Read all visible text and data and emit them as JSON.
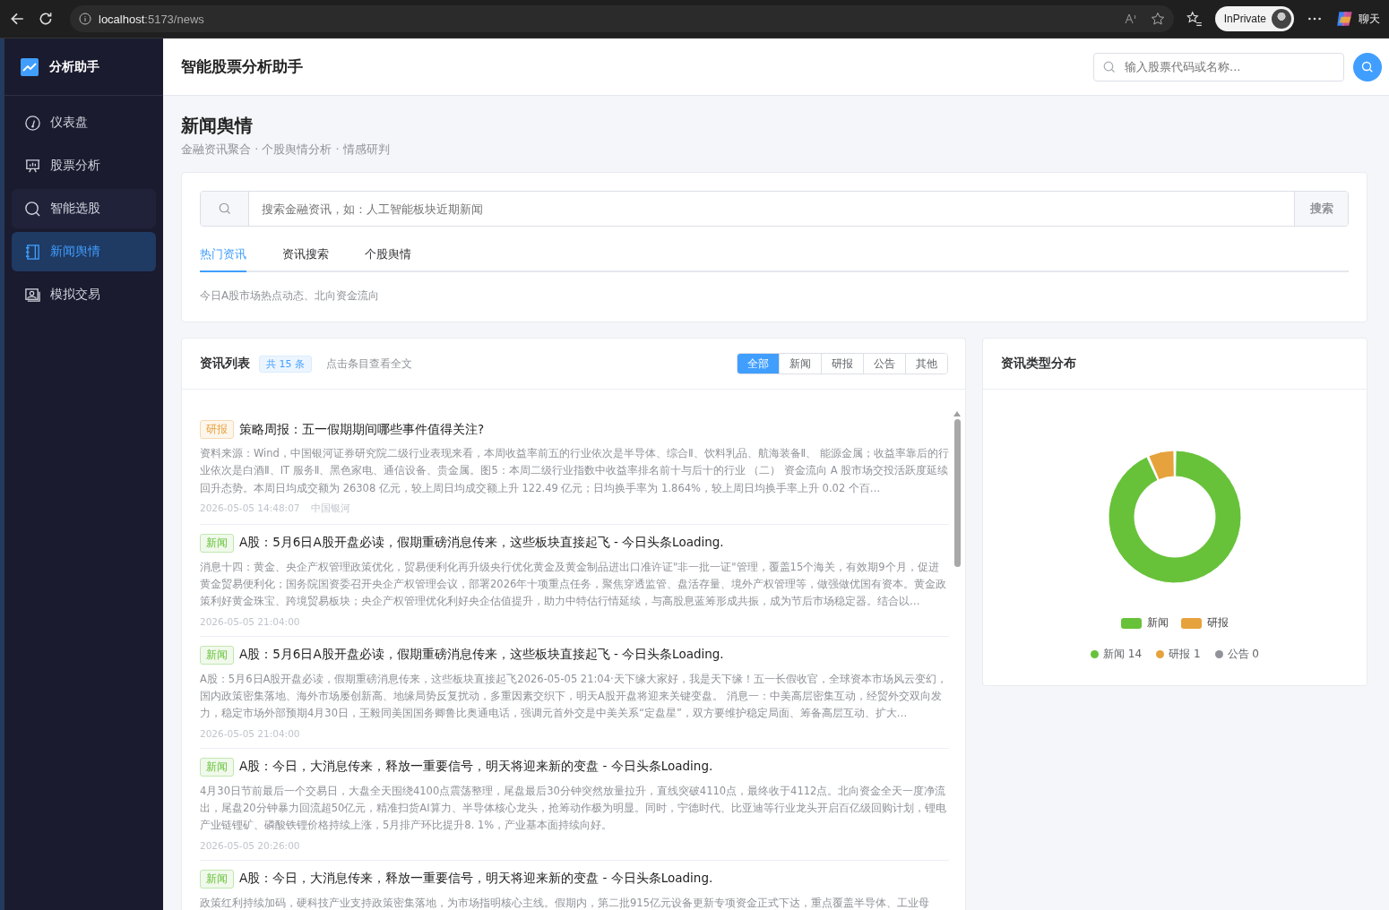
{
  "browser": {
    "url_host": "localhost",
    "url_rest": ":5173/news",
    "private_label": "InPrivate",
    "chat_label": "聊天"
  },
  "sidebar": {
    "brand": "分析助手",
    "items": [
      {
        "label": "仪表盘",
        "selected": false,
        "hovered": false
      },
      {
        "label": "股票分析",
        "selected": false,
        "hovered": false
      },
      {
        "label": "智能选股",
        "selected": false,
        "hovered": true
      },
      {
        "label": "新闻舆情",
        "selected": true,
        "hovered": false
      },
      {
        "label": "模拟交易",
        "selected": false,
        "hovered": false
      }
    ]
  },
  "header": {
    "title": "智能股票分析助手",
    "search": {
      "placeholder": "输入股票代码或名称..."
    }
  },
  "page": {
    "title": "新闻舆情",
    "subtitle": "金融资讯聚合 · 个股舆情分析 · 情感研判"
  },
  "search_panel": {
    "placeholder": "搜索金融资讯，如：人工智能板块近期新闻",
    "button": "搜索",
    "tabs": [
      {
        "label": "热门资讯",
        "selected": true
      },
      {
        "label": "资讯搜索",
        "selected": false
      },
      {
        "label": "个股舆情",
        "selected": false
      }
    ],
    "hint": "今日A股市场热点动态、北向资金流向"
  },
  "news_list": {
    "title": "资讯列表",
    "count": "共 15 条",
    "hint": "点击条目查看全文",
    "filters": [
      {
        "label": "全部",
        "selected": true
      },
      {
        "label": "新闻",
        "selected": false
      },
      {
        "label": "研报",
        "selected": false
      },
      {
        "label": "公告",
        "selected": false
      },
      {
        "label": "其他",
        "selected": false
      }
    ],
    "items": [
      {
        "kind": "report",
        "tag": "研报",
        "title": "策略周报：五一假期期间哪些事件值得关注?",
        "summary": "资料来源：Wind，中国银河证券研究院二级行业表现来看，本周收益率前五的行业依次是半导体、综合Ⅱ、饮料乳品、航海装备Ⅱ、 能源金属；收益率靠后的行业依次是白酒Ⅱ、IT 服务Ⅱ、黑色家电、通信设备、贵金属。图5：本周二级行业指数中收益率排名前十与后十的行业 （二） 资金流向 A 股市场交投活跃度延续回升态势。本周日均成交额为 26308 亿元，较上周日均成交额上升 122.49 亿元；日均换手率为 1.864%，较上周日均换手率上升 0.02 个百…",
        "time": "2026-05-05 14:48:07",
        "source": "中国银河"
      },
      {
        "kind": "news",
        "tag": "新闻",
        "title": "A股：5月6日A股开盘必读，假期重磅消息传来，这些板块直接起飞 - 今日头条Loading.",
        "summary": "消息十四：黄金、央企产权管理政策优化，贸易便利化再升级央行优化黄金及黄金制品进出口准许证\"非一批一证\"管理，覆盖15个海关，有效期9个月，促进黄金贸易便利化；国务院国资委召开央企产权管理会议，部署2026年十项重点任务，聚焦穿透监管、盘活存量、境外产权管理等，做强做优国有资本。黄金政策利好黄金珠宝、跨境贸易板块；央企产权管理优化利好央企估值提升，助力中特估行情延续，与高股息蓝筹形成共振，成为节后市场稳定器。结合以…",
        "time": "2026-05-05 21:04:00"
      },
      {
        "kind": "news",
        "tag": "新闻",
        "title": "A股：5月6日A股开盘必读，假期重磅消息传来，这些板块直接起飞 - 今日头条Loading.",
        "summary": "A股：5月6日A股开盘必读，假期重磅消息传来，这些板块直接起飞2026-05-05 21:04·天下缘大家好，我是天下缘！五一长假收官，全球资本市场风云变幻，国内政策密集落地、海外市场屡创新高、地缘局势反复扰动，多重因素交织下，明天A股开盘将迎来关键变盘。 消息一：中美高层密集互动，经贸外交双向发力，稳定市场外部预期4月30日，王毅同美国国务卿鲁比奥通电话，强调元首外交是中美关系“定盘星”，双方要维护稳定局面、筹备高层互动、扩大…",
        "time": "2026-05-05 21:04:00"
      },
      {
        "kind": "news",
        "tag": "新闻",
        "title": "A股：今日，大消息传来，释放一重要信号，明天将迎来新的变盘 - 今日头条Loading.",
        "summary": "4月30日节前最后一个交易日，大盘全天围绕4100点震荡整理，尾盘最后30分钟突然放量拉升，直线突破4110点，最终收于4112点。北向资金全天一度净流出，尾盘20分钟暴力回流超50亿元，精准扫货AI算力、半导体核心龙头，抢筹动作极为明显。同时，宁德时代、比亚迪等行业龙头开启百亿级回购计划，锂电产业链锂矿、磷酸铁锂价格持续上涨，5月排产环比提升8. 1%，产业基本面持续向好。",
        "time": "2026-05-05 20:26:00"
      },
      {
        "kind": "news",
        "tag": "新闻",
        "title": "A股：今日，大消息传来，释放一重要信号，明天将迎来新的变盘 - 今日头条Loading.",
        "summary": "政策红利持续加码，硬科技产业支持政策密集落地，为市场指明核心主线。假期内，第二批915亿元设备更新专项资金正式下达，重点覆盖半导体、工业母"
      }
    ]
  },
  "type_chart": {
    "title": "资讯类型分布",
    "chart_data": {
      "type": "donut",
      "categories": [
        "新闻",
        "研报"
      ],
      "values": [
        93.3,
        6.7
      ],
      "colors": [
        "#67c23a",
        "#e6a23c"
      ],
      "legend": "bottom"
    },
    "counts": [
      {
        "label": "新闻 14",
        "color": "#67c23a"
      },
      {
        "label": "研报 1",
        "color": "#e6a23c"
      },
      {
        "label": "公告 0",
        "color": "#909399"
      }
    ]
  }
}
